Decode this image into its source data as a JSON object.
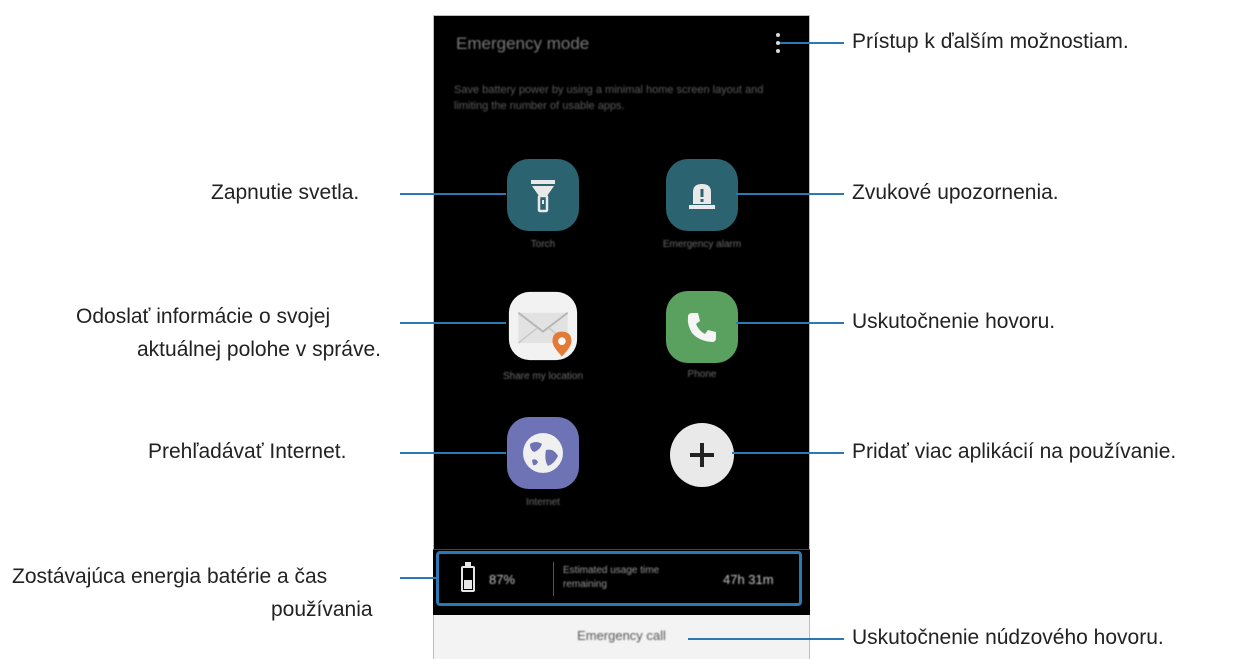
{
  "screen": {
    "title": "Emergency mode",
    "description": "Save battery power by using a minimal home screen layout and limiting the number of usable apps.",
    "apps": [
      {
        "label": "Torch",
        "icon": "torch-icon",
        "color": "#2b6371"
      },
      {
        "label": "Emergency alarm",
        "icon": "alarm-icon",
        "color": "#2b6371"
      },
      {
        "label": "Share my location",
        "icon": "envelope-location-icon",
        "color": "#f2f2f2"
      },
      {
        "label": "Phone",
        "icon": "phone-icon",
        "color": "#5aa05f"
      },
      {
        "label": "Internet",
        "icon": "globe-icon",
        "color": "#6e73b5"
      },
      {
        "label": "",
        "icon": "plus-icon",
        "color": "#e9e9e9"
      }
    ],
    "battery": {
      "percent": "87%",
      "estimate_label": "Estimated usage time remaining",
      "time": "47h 31m"
    },
    "emergency_call": "Emergency call"
  },
  "callouts": {
    "more_options": "Prístup k ďalším možnostiam.",
    "torch": "Zapnutie svetla.",
    "alarm": "Zvukové upozornenia.",
    "share_location_1": "Odoslať informácie o svojej",
    "share_location_2": "aktuálnej polohe v správe.",
    "phone": "Uskutočnenie hovoru.",
    "internet": "Prehľadávať Internet.",
    "add_apps": "Pridať viac aplikácií na používanie.",
    "battery_1": "Zostávajúca energia batérie a čas",
    "battery_2": "používania",
    "emergency_call": "Uskutočnenie núdzového hovoru."
  },
  "colors": {
    "accent_line": "#2a79b4"
  }
}
